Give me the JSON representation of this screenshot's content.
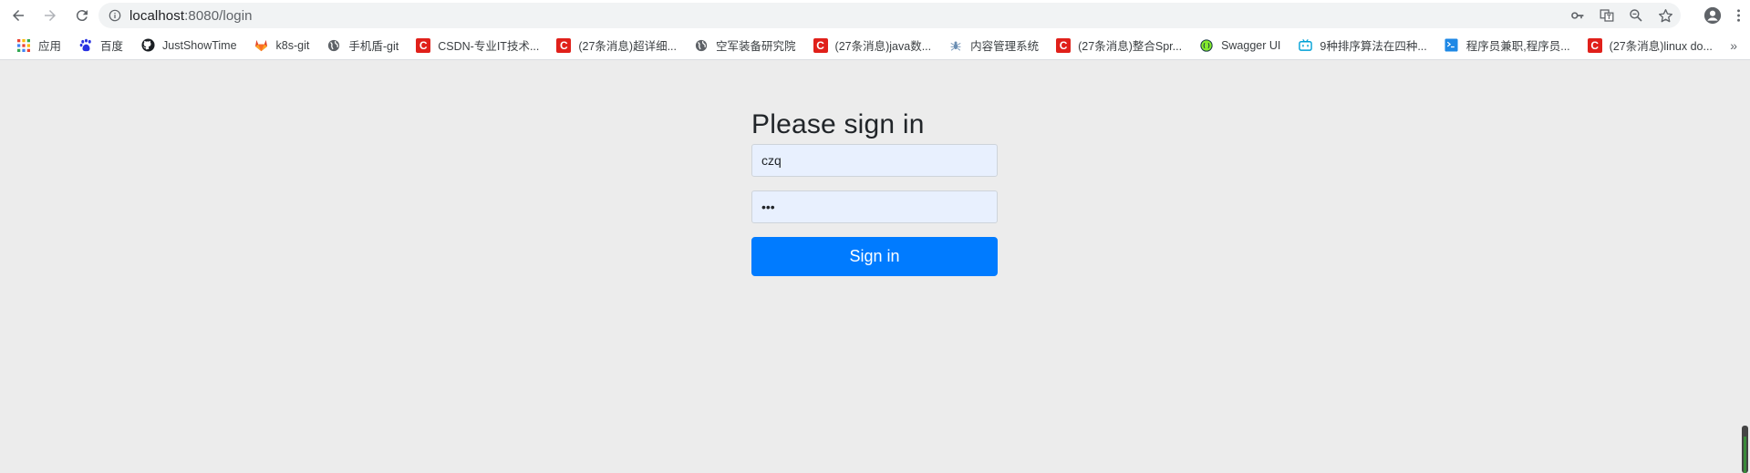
{
  "browser": {
    "url_host": "localhost",
    "url_rest": ":8080/login"
  },
  "bookmarks": [
    {
      "label": "应用",
      "icon": "apps-grid-icon"
    },
    {
      "label": "百度",
      "icon": "baidu-icon"
    },
    {
      "label": "JustShowTime",
      "icon": "github-icon"
    },
    {
      "label": "k8s-git",
      "icon": "gitlab-icon"
    },
    {
      "label": "手机盾-git",
      "icon": "globe-icon"
    },
    {
      "label": "CSDN-专业IT技术...",
      "icon": "csdn-icon"
    },
    {
      "label": "(27条消息)超详细...",
      "icon": "csdn-icon"
    },
    {
      "label": "空军装备研究院",
      "icon": "globe-icon"
    },
    {
      "label": "(27条消息)java数...",
      "icon": "csdn-icon"
    },
    {
      "label": "内容管理系统",
      "icon": "spider-icon"
    },
    {
      "label": "(27条消息)整合Spr...",
      "icon": "csdn-icon"
    },
    {
      "label": "Swagger UI",
      "icon": "swagger-icon"
    },
    {
      "label": "9种排序算法在四种...",
      "icon": "bilibili-icon"
    },
    {
      "label": "程序员兼职,程序员...",
      "icon": "terminal-icon"
    },
    {
      "label": "(27条消息)linux do...",
      "icon": "csdn-icon"
    }
  ],
  "bookmarks_overflow": "»",
  "form": {
    "heading": "Please sign in",
    "username_value": "czq",
    "password_value": "•••",
    "submit_label": "Sign in"
  },
  "colors": {
    "primary": "#007bff",
    "page_bg": "#ececec",
    "autofill_bg": "#e8f0fe"
  }
}
